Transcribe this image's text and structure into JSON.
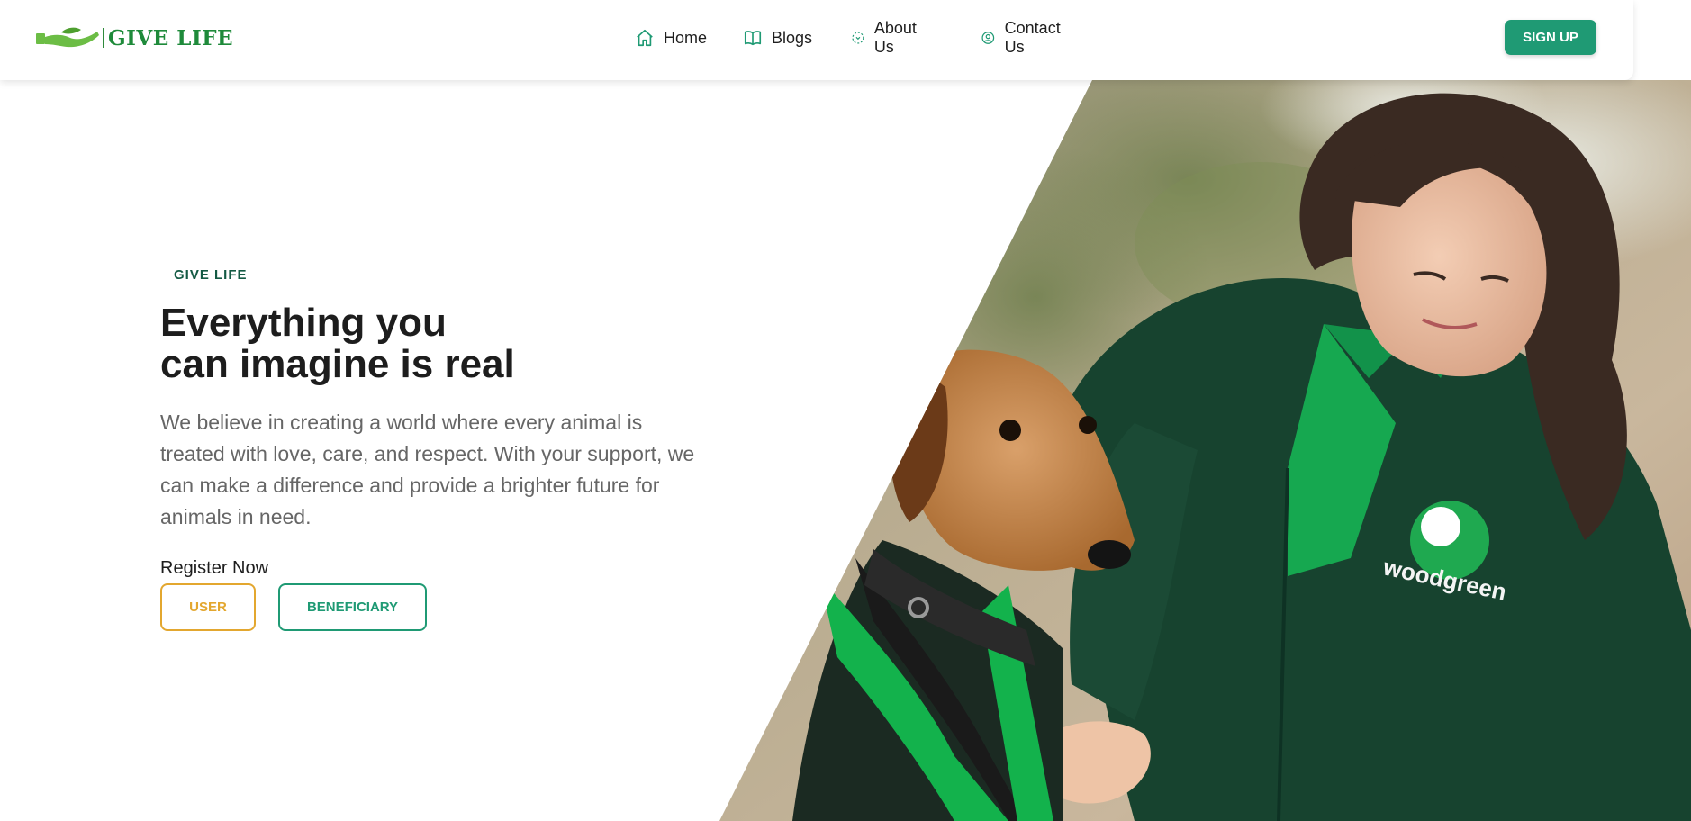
{
  "brand": {
    "name": "GIVE LIFE",
    "logo_icon": "hand-holding-leaf-icon",
    "color": "#1e8a3a"
  },
  "nav": {
    "items": [
      {
        "label": "Home",
        "icon": "home-icon"
      },
      {
        "label": "Blogs",
        "icon": "book-icon"
      },
      {
        "label": "About Us",
        "icon": "about-dashed-circle-icon"
      },
      {
        "label": "Contact Us",
        "icon": "user-circle-icon"
      }
    ],
    "signup_label": "SIGN UP"
  },
  "hero": {
    "eyebrow": "GIVE LIFE",
    "headline_line1": "Everything you",
    "headline_line2": "can imagine is real",
    "description": "We believe in creating a world where every animal is treated with love, care, and respect. With your support, we can make a difference and provide a brighter future for animals in need.",
    "register_label": "Register Now",
    "buttons": {
      "user": "USER",
      "beneficiary": "BENEFICIARY"
    },
    "image_alt": "Volunteer in green hoodie with a dog wearing a green coat",
    "badge_text": "woodgreen"
  },
  "colors": {
    "accent_green": "#1f9a74",
    "accent_orange": "#e3a72f",
    "dark_green_text": "#145a44"
  }
}
